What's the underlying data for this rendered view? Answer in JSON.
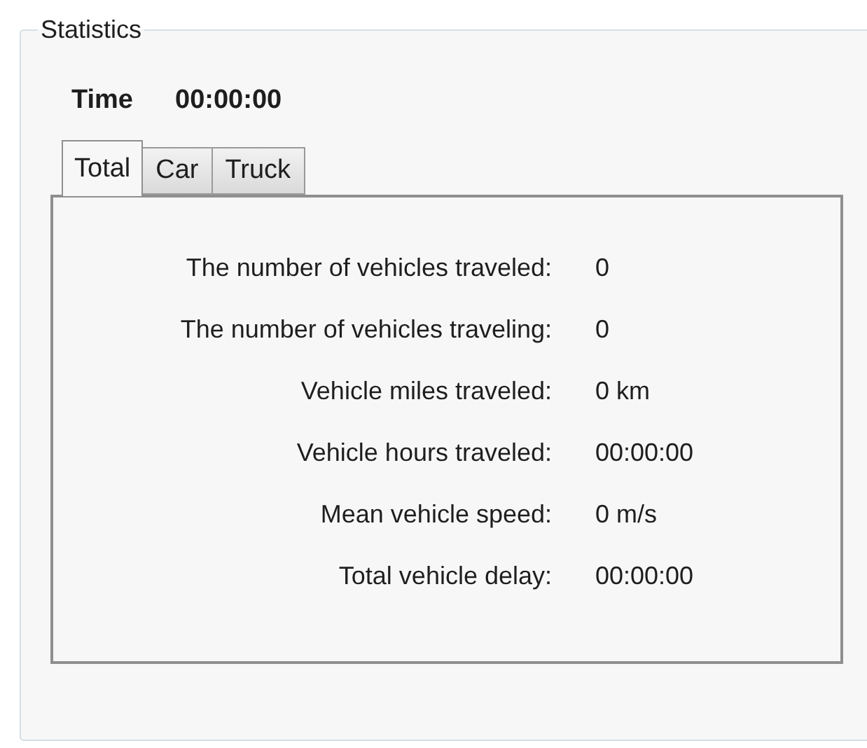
{
  "group": {
    "title": "Statistics"
  },
  "time": {
    "label": "Time",
    "value": "00:00:00"
  },
  "tabs": [
    {
      "label": "Total",
      "selected": true
    },
    {
      "label": "Car",
      "selected": false
    },
    {
      "label": "Truck",
      "selected": false
    }
  ],
  "stats": [
    {
      "label": "The number of vehicles traveled:",
      "value": "0"
    },
    {
      "label": "The number of vehicles traveling:",
      "value": "0"
    },
    {
      "label": "Vehicle miles traveled:",
      "value": "0 km"
    },
    {
      "label": "Vehicle hours traveled:",
      "value": "00:00:00"
    },
    {
      "label": "Mean vehicle speed:",
      "value": "0 m/s"
    },
    {
      "label": "Total vehicle delay:",
      "value": "00:00:00"
    }
  ]
}
